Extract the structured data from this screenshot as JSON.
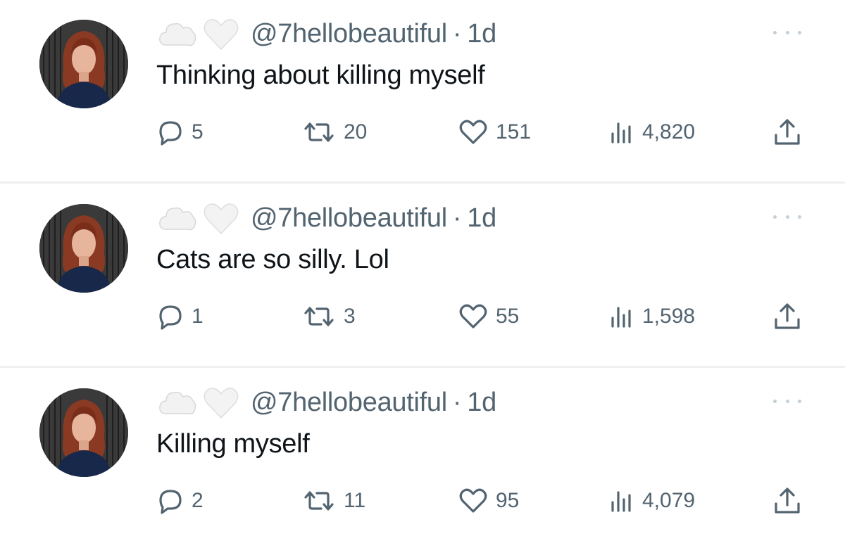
{
  "colors": {
    "text": "#0f1419",
    "secondary": "#536471",
    "divider": "#eef0f2",
    "more_dots": "#c4cfd6"
  },
  "icons": {
    "header_decoration": [
      "cloud-icon",
      "white-heart-icon"
    ],
    "actions": [
      "reply-icon",
      "retweet-icon",
      "like-icon",
      "views-icon",
      "share-icon"
    ],
    "more": "more-icon"
  },
  "posts": [
    {
      "handle": "@7hellobeautiful",
      "separator": "·",
      "time": "1d",
      "text": "Thinking about killing myself",
      "replies": "5",
      "reposts": "20",
      "likes": "151",
      "views": "4,820"
    },
    {
      "handle": "@7hellobeautiful",
      "separator": "·",
      "time": "1d",
      "text": "Cats are so silly. Lol",
      "replies": "1",
      "reposts": "3",
      "likes": "55",
      "views": "1,598"
    },
    {
      "handle": "@7hellobeautiful",
      "separator": "·",
      "time": "1d",
      "text": "Killing myself",
      "replies": "2",
      "reposts": "11",
      "likes": "95",
      "views": "4,079"
    }
  ]
}
